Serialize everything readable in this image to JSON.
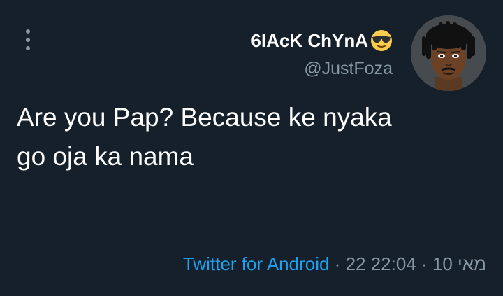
{
  "author": {
    "display_name": "6lAcK ChYnA",
    "handle": "@JustFoza",
    "emoji_icon": "smiling-face-with-sunglasses"
  },
  "avatar": {
    "icon": "profile-avatar-illustration"
  },
  "menu": {
    "icon": "more-vertical-icon"
  },
  "tweet": {
    "text_line1": "Are you Pap? Because ke nyaka",
    "text_line2": "go oja ka nama"
  },
  "meta": {
    "source": "Twitter for Android",
    "separator1": " · ",
    "date": "22 מאי 10",
    "separator2": " · ",
    "time": "22:04"
  },
  "colors": {
    "background": "#15202b",
    "text": "#ffffff",
    "secondary": "#8899a6",
    "accent": "#1da1f2"
  }
}
